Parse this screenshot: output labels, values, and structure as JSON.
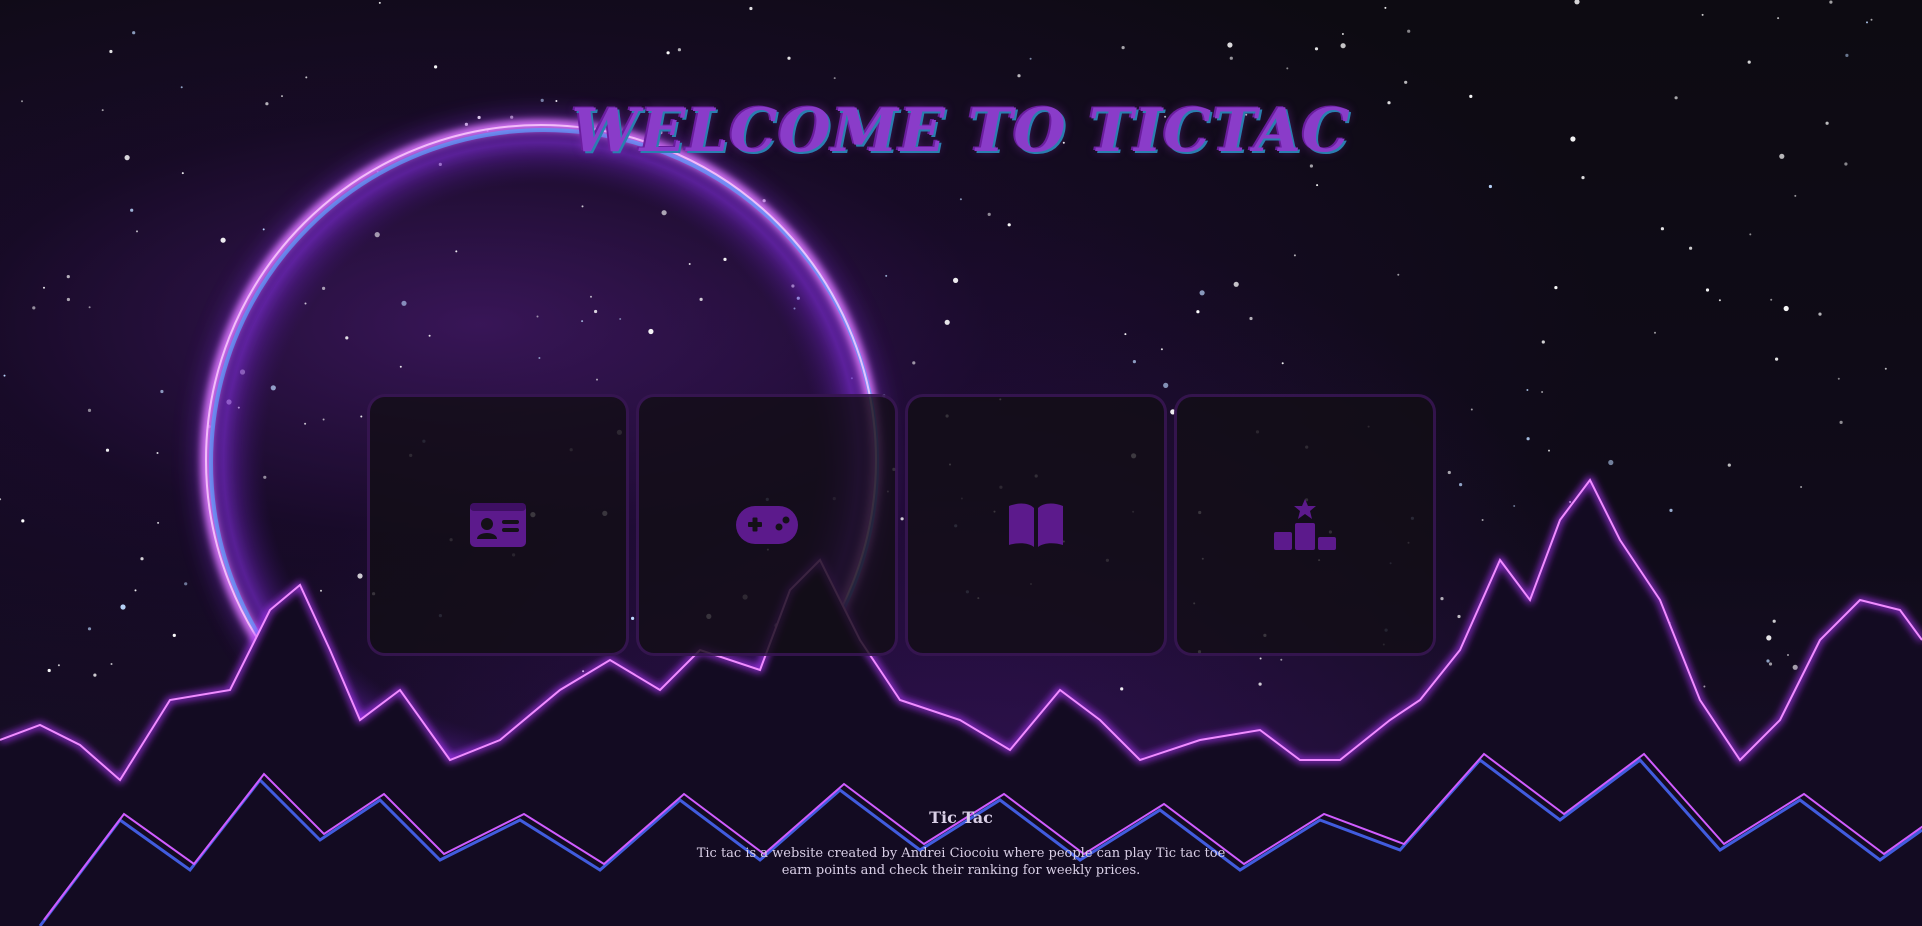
{
  "header": {
    "title": "WELCOME TO TICTAC"
  },
  "menu": {
    "tiles": [
      {
        "icon": "id-card-icon"
      },
      {
        "icon": "gamepad-icon"
      },
      {
        "icon": "book-open-icon"
      },
      {
        "icon": "ranking-podium-icon"
      }
    ],
    "icon_color": "#5c1a8c"
  },
  "footer": {
    "title": "Tic Tac",
    "text": "Tic tac is a website created by Andrei Ciocoiu where people can play Tic tac toe earn points and check their ranking for weekly prices."
  },
  "colors": {
    "title": "#8a3cc9",
    "planet_ring": "#d86bff",
    "mountains": "#b036ff"
  }
}
